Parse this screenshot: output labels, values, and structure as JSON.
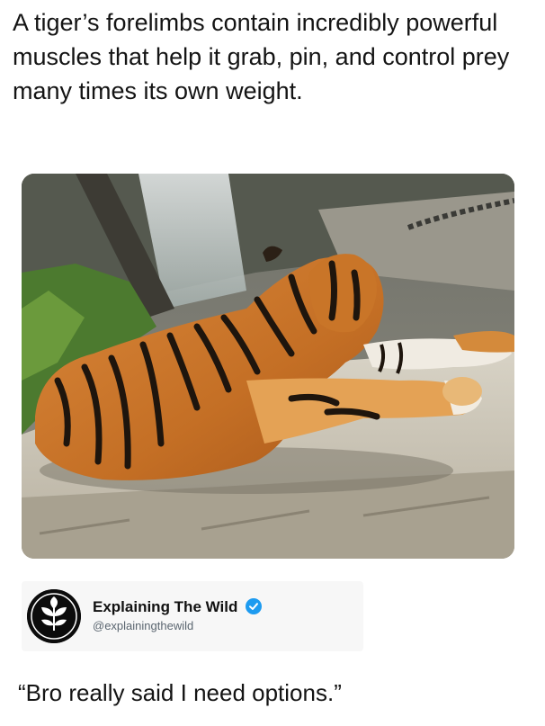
{
  "post": {
    "caption": "A tiger’s forelimbs contain incredibly powerful muscles that help it grab, pin, and control prey many times its own weight.",
    "image": {
      "subject_icon": "tiger-photo"
    }
  },
  "attribution": {
    "name": "Explaining The Wild",
    "handle": "@explainingthewild",
    "verified_icon": "verified-badge-icon",
    "avatar_icon": "leaf-logo-icon",
    "verified_color": "#1d9bf0"
  },
  "quote": "“Bro really said I need options.”"
}
